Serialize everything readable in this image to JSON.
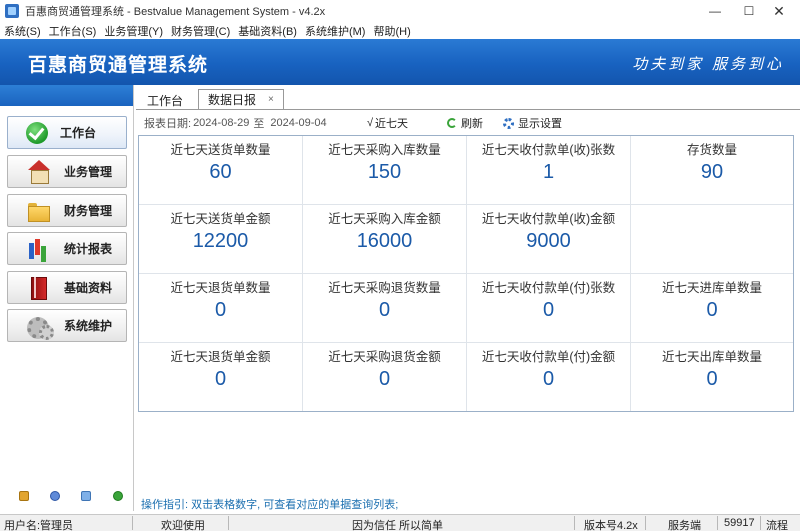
{
  "window": {
    "title": "百惠商贸通管理系统 - Bestvalue Management System - v4.2x",
    "min_glyph": "—",
    "max_glyph": "☐",
    "close_glyph": "✕"
  },
  "menu": [
    "系统(S)",
    "工作台(S)",
    "业务管理(Y)",
    "财务管理(C)",
    "基础资料(B)",
    "系统维护(M)",
    "帮助(H)"
  ],
  "banner": {
    "app_name": "百惠商贸通管理系统",
    "slogan": "功夫到家 服务到心"
  },
  "sidebar": {
    "items": [
      {
        "label": "工作台",
        "icon": "check-circle-icon"
      },
      {
        "label": "业务管理",
        "icon": "house-icon"
      },
      {
        "label": "财务管理",
        "icon": "folder-icon"
      },
      {
        "label": "统计报表",
        "icon": "bar-chart-icon"
      },
      {
        "label": "基础资料",
        "icon": "book-icon"
      },
      {
        "label": "系统维护",
        "icon": "gears-icon"
      }
    ]
  },
  "tabs": [
    {
      "label": "工作台"
    },
    {
      "label": "数据日报",
      "close": "×"
    }
  ],
  "toolbar": {
    "date_label": "报表日期:",
    "date_from": "2024-08-29",
    "date_sep": "至",
    "date_to": "2024-09-04",
    "last7_check": "√",
    "last7_label": "近七天",
    "refresh_label": "刷新",
    "settings_label": "显示设置"
  },
  "grid": {
    "cells": [
      {
        "label": "近七天送货单数量",
        "value": "60"
      },
      {
        "label": "近七天采购入库数量",
        "value": "150"
      },
      {
        "label": "近七天收付款单(收)张数",
        "value": "1"
      },
      {
        "label": "存货数量",
        "value": "90"
      },
      {
        "label": "近七天送货单金额",
        "value": "12200"
      },
      {
        "label": "近七天采购入库金额",
        "value": "16000"
      },
      {
        "label": "近七天收付款单(收)金额",
        "value": "9000"
      },
      {
        "label": "",
        "value": ""
      },
      {
        "label": "近七天退货单数量",
        "value": "0"
      },
      {
        "label": "近七天采购退货数量",
        "value": "0"
      },
      {
        "label": "近七天收付款单(付)张数",
        "value": "0"
      },
      {
        "label": "近七天进库单数量",
        "value": "0"
      },
      {
        "label": "近七天退货单金额",
        "value": "0"
      },
      {
        "label": "近七天采购退货金额",
        "value": "0"
      },
      {
        "label": "近七天收付款单(付)金额",
        "value": "0"
      },
      {
        "label": "近七天出库单数量",
        "value": "0"
      }
    ]
  },
  "hint": "操作指引: 双击表格数字, 可查看对应的单据查询列表;",
  "status": {
    "user": "用户名:管理员",
    "welcome": "欢迎使用",
    "motto": "因为信任 所以简单",
    "version": "版本号4.2x",
    "server": "服务端",
    "port": "59917",
    "flow": "流程"
  },
  "colors": {
    "banner": "#1862c0",
    "value_text": "#1b5aa8",
    "hint_text": "#1b6fb0"
  }
}
